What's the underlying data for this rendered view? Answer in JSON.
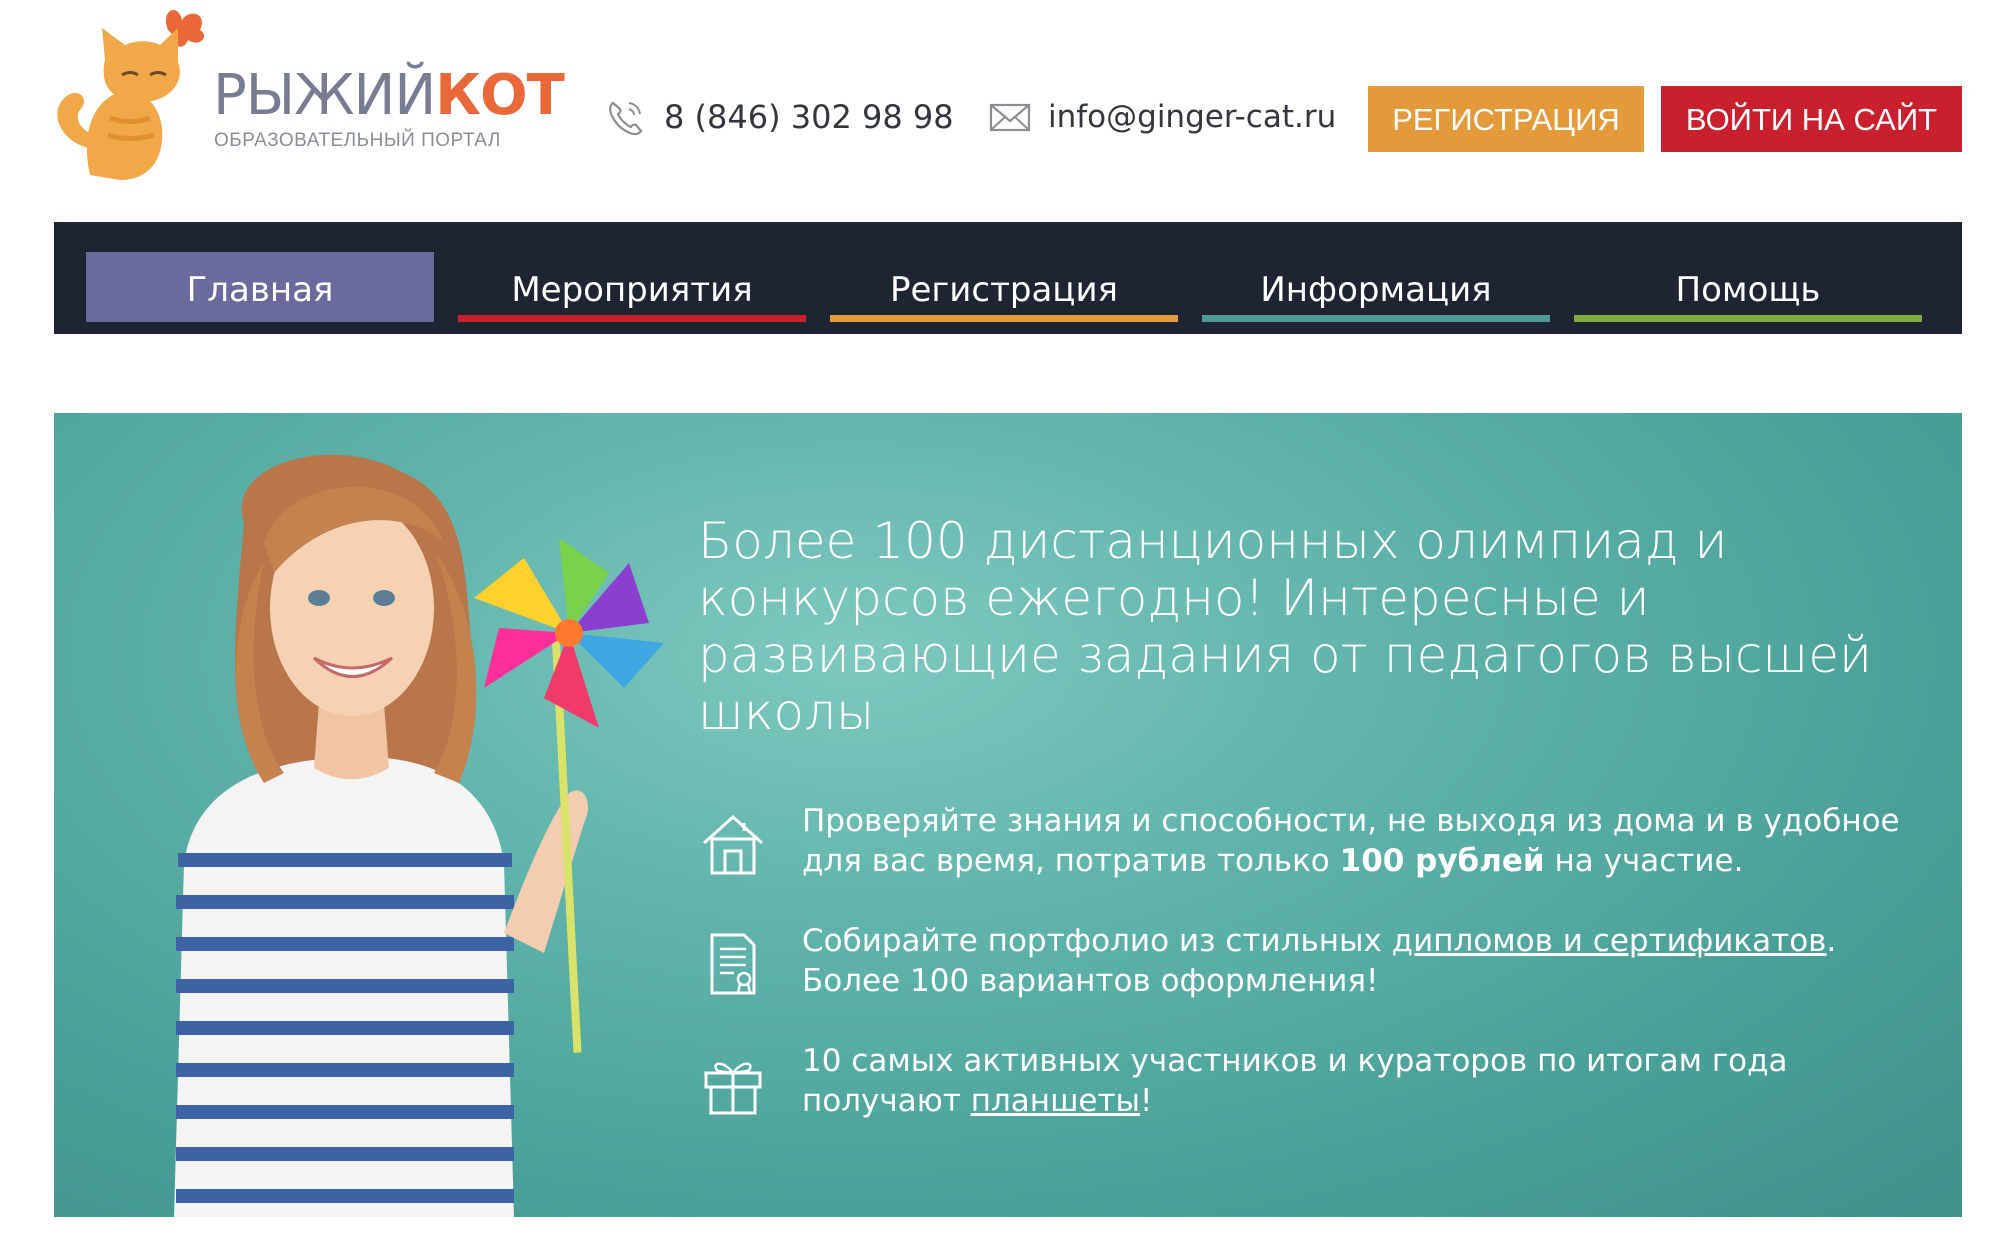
{
  "header": {
    "logo": {
      "title_part1": "РЫЖИЙ",
      "title_part2": "КОТ",
      "subtitle": "ОБРАЗОВАТЕЛЬНЫЙ ПОРТАЛ"
    },
    "phone": "8 (846) 302 98 98",
    "email": "info@ginger-cat.ru",
    "register_button": "РЕГИСТРАЦИЯ",
    "login_button": "ВОЙТИ НА САЙТ"
  },
  "nav": {
    "items": [
      {
        "label": "Главная",
        "color": "#6a6a9d",
        "active": true
      },
      {
        "label": "Мероприятия",
        "color": "#c8212d"
      },
      {
        "label": "Регистрация",
        "color": "#e39a3a"
      },
      {
        "label": "Информация",
        "color": "#4f9a96"
      },
      {
        "label": "Помощь",
        "color": "#7fac3e"
      }
    ]
  },
  "hero": {
    "title": "Более 100 дистанционных олимпиад и конкурсов ежегодно! Интересные и развивающие задания от педагогов высшей школы",
    "features": [
      {
        "icon": "house-icon",
        "text_before": "Проверяйте знания и способности, не выходя из дома и в удобное для вас время, потратив только ",
        "text_bold": "100 рублей",
        "text_after": " на участие."
      },
      {
        "icon": "document-icon",
        "text_before": "Собирайте портфолио из стильных ",
        "link": "дипломов и сертификатов",
        "text_after": ". Более 100 вариантов оформления!"
      },
      {
        "icon": "gift-icon",
        "text_before": "10 самых активных участников и кураторов по итогам года получают ",
        "link": "планшеты",
        "text_after": "!"
      }
    ]
  },
  "colors": {
    "nav_bg": "#1e2431",
    "register": "#e39a3a",
    "login": "#c8212d",
    "hero_bg": "#5fb3aa",
    "logo_orange": "#e8683a"
  }
}
